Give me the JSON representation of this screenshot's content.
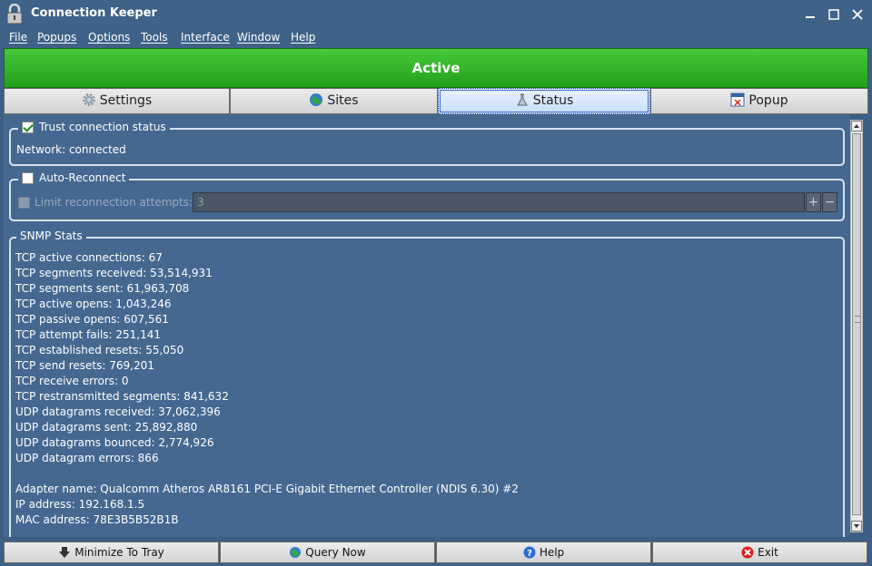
{
  "window": {
    "title": "Connection Keeper",
    "controls": {
      "minimize": "🗕",
      "maximize": "□",
      "close": "✕"
    },
    "icon": "padlock-icon"
  },
  "menu": [
    "File",
    "Popups",
    "Options",
    "Tools",
    "Interface",
    "Window",
    "Help"
  ],
  "banner": {
    "status": "Active",
    "color": "#2fb326"
  },
  "tabs": [
    {
      "label": "Settings",
      "icon": "gear-icon"
    },
    {
      "label": "Sites",
      "icon": "globe-icon"
    },
    {
      "label": "Status",
      "icon": "flask-icon",
      "selected": true
    },
    {
      "label": "Popup",
      "icon": "popup-window-icon"
    }
  ],
  "trust": {
    "label": "Trust connection status",
    "checked": true,
    "network_status": "Network: connected"
  },
  "reconnect": {
    "label": "Auto-Reconnect",
    "checked": false,
    "limit_label": "Limit reconnection attempts:",
    "limit_checked": false,
    "limit_value": "3",
    "plus": "+",
    "minus": "−"
  },
  "snmp": {
    "title": "SNMP Stats",
    "stats": [
      "TCP active connections: 67",
      "TCP segments received: 53,514,931",
      "TCP segments sent: 61,963,708",
      "TCP active opens: 1,043,246",
      "TCP passive opens: 607,561",
      "TCP attempt fails: 251,141",
      "TCP established resets: 55,050",
      "TCP send resets: 769,201",
      "TCP receive errors: 0",
      "TCP restransmitted segments: 841,632",
      "UDP datagrams received: 37,062,396",
      "UDP datagrams sent: 25,892,880",
      "UDP datagrams bounced: 2,774,926",
      "UDP datagram errors: 866"
    ],
    "adapter": [
      "Adapter name: Qualcomm Atheros AR8161 PCI-E Gigabit Ethernet Controller (NDIS 6.30) #2",
      "IP address: 192.168.1.5",
      "MAC address: 78E3B5B52B1B"
    ]
  },
  "buttons": [
    {
      "label": "Minimize To Tray",
      "icon": "down-arrow-icon"
    },
    {
      "label": "Query Now",
      "icon": "globe-refresh-icon"
    },
    {
      "label": "Help",
      "icon": "help-icon"
    },
    {
      "label": "Exit",
      "icon": "exit-icon"
    }
  ]
}
